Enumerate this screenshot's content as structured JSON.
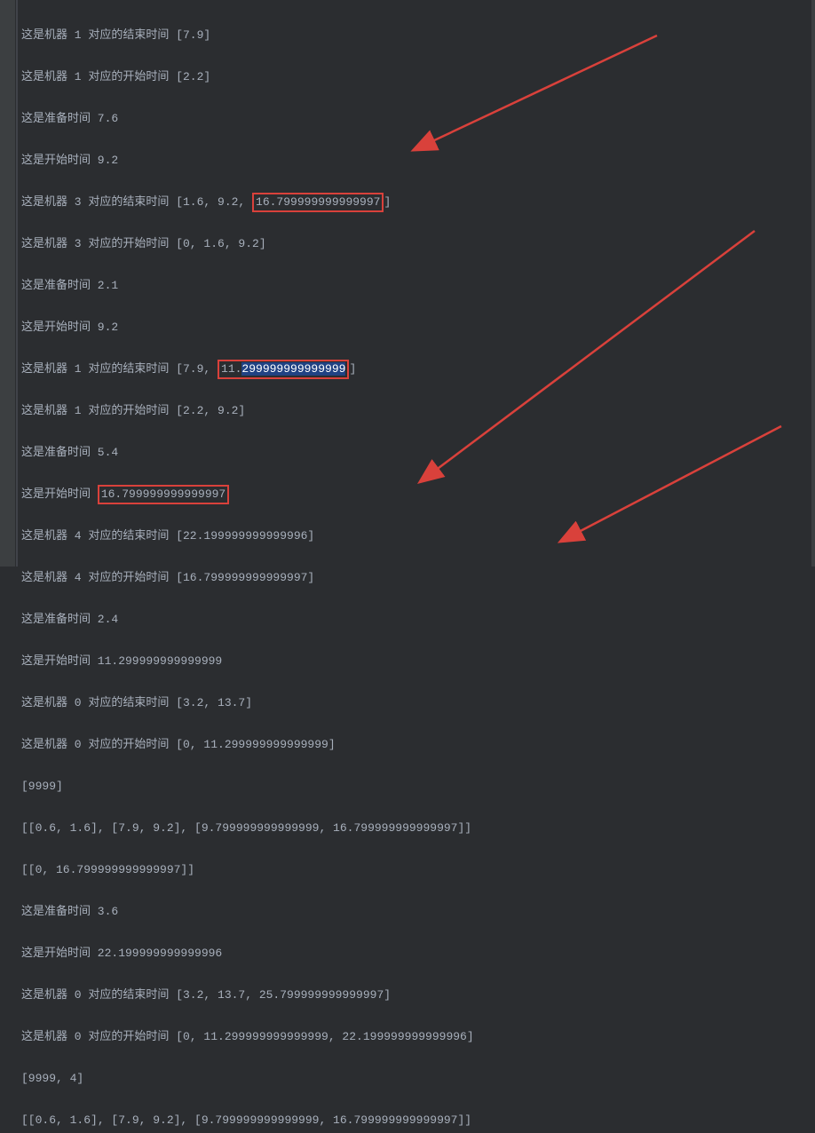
{
  "lines": [
    {
      "prefix": "这是机器 1 对应的结束时间 [7.9]",
      "boxed": null,
      "suffix": null
    },
    {
      "prefix": "这是机器 1 对应的开始时间 [2.2]",
      "boxed": null,
      "suffix": null
    },
    {
      "prefix": "这是准备时间 7.6",
      "boxed": null,
      "suffix": null
    },
    {
      "prefix": "这是开始时间 9.2",
      "boxed": null,
      "suffix": null
    },
    {
      "prefix": "这是机器 3 对应的结束时间 [1.6, 9.2, ",
      "boxed": "16.799999999999997",
      "suffix": "]"
    },
    {
      "prefix": "这是机器 3 对应的开始时间 [0, 1.6, 9.2]",
      "boxed": null,
      "suffix": null
    },
    {
      "prefix": "这是准备时间 2.1",
      "boxed": null,
      "suffix": null
    },
    {
      "prefix": "这是开始时间 9.2",
      "boxed": null,
      "suffix": null
    },
    {
      "prefix": "这是机器 1 对应的结束时间 [7.9, ",
      "boxed_prefix": "11.",
      "boxed_sel": "299999999999999",
      "suffix": "]"
    },
    {
      "prefix": "这是机器 1 对应的开始时间 [2.2, 9.2]",
      "boxed": null,
      "suffix": null
    },
    {
      "prefix": "这是准备时间 5.4",
      "boxed": null,
      "suffix": null
    },
    {
      "prefix": "这是开始时间 ",
      "boxed": "16.799999999999997",
      "suffix": null
    },
    {
      "prefix": "这是机器 4 对应的结束时间 [22.199999999999996]",
      "boxed": null,
      "suffix": null
    },
    {
      "prefix": "这是机器 4 对应的开始时间 [16.799999999999997]",
      "boxed": null,
      "suffix": null
    },
    {
      "prefix": "这是准备时间 2.4",
      "boxed": null,
      "suffix": null
    },
    {
      "prefix": "这是开始时间 11.299999999999999",
      "boxed": null,
      "suffix": null
    },
    {
      "prefix": "这是机器 0 对应的结束时间 [3.2, 13.7]",
      "boxed": null,
      "suffix": null
    },
    {
      "prefix": "这是机器 0 对应的开始时间 [0, 11.299999999999999]",
      "boxed": null,
      "suffix": null
    },
    {
      "prefix": "[9999]",
      "boxed": null,
      "suffix": null
    },
    {
      "prefix": "[[0.6, 1.6], [7.9, 9.2], [9.799999999999999, 16.799999999999997]]",
      "boxed": null,
      "suffix": null
    },
    {
      "prefix": "[[0, 16.799999999999997]]",
      "boxed": null,
      "suffix": null
    },
    {
      "prefix": "这是准备时间 3.6",
      "boxed": null,
      "suffix": null
    },
    {
      "prefix": "这是开始时间 22.199999999999996",
      "boxed": null,
      "suffix": null
    },
    {
      "prefix": "这是机器 0 对应的结束时间 [3.2, 13.7, 25.799999999999997]",
      "boxed": null,
      "suffix": null
    },
    {
      "prefix": "这是机器 0 对应的开始时间 [0, 11.299999999999999, 22.199999999999996]",
      "boxed": null,
      "suffix": null
    },
    {
      "prefix": "[9999, 4]",
      "boxed": null,
      "suffix": null
    },
    {
      "prefix": "[[0.6, 1.6], [7.9, 9.2], [9.799999999999999, 16.799999999999997]]",
      "boxed": null,
      "suffix": null
    }
  ]
}
